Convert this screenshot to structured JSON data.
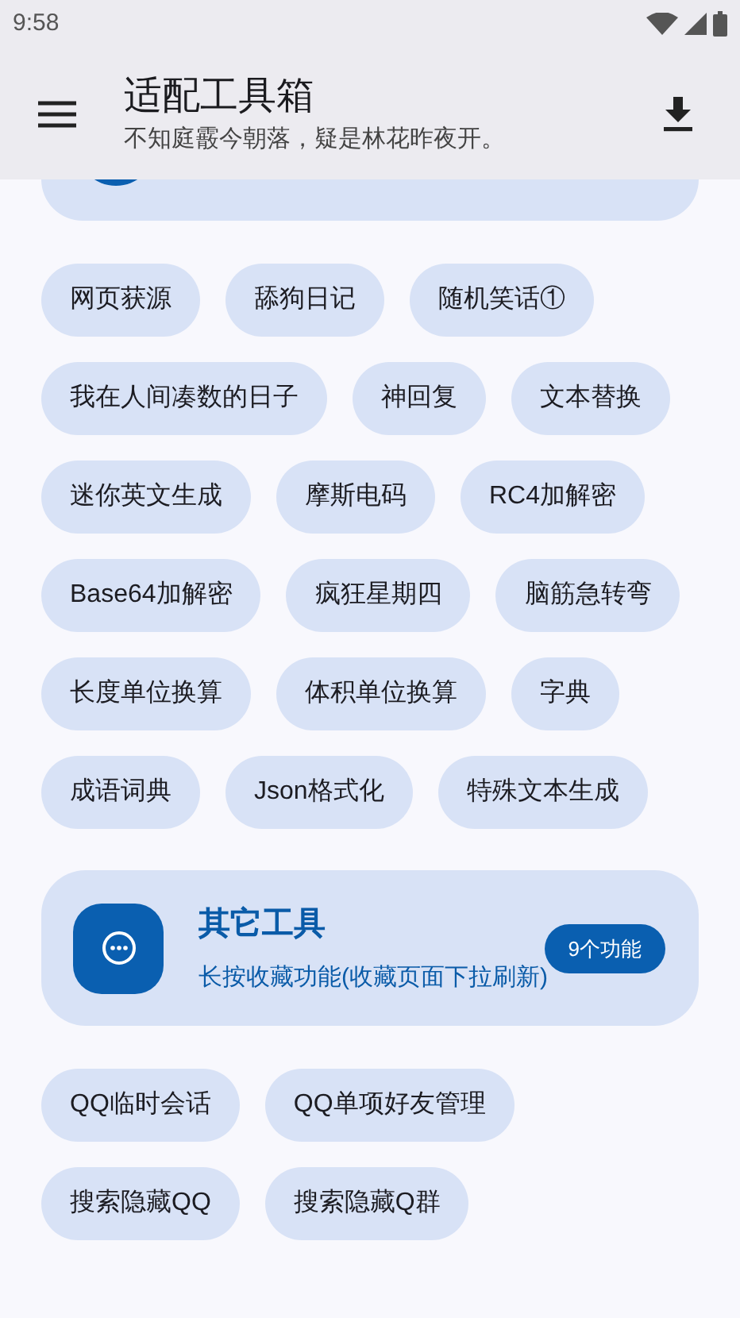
{
  "status_bar": {
    "time": "9:58"
  },
  "app_bar": {
    "title": "适配工具箱",
    "subtitle": "不知庭霰今朝落，疑是林花昨夜开。"
  },
  "tools_top": [
    "网页获源",
    "舔狗日记",
    "随机笑话①",
    "我在人间凑数的日子",
    "神回复",
    "文本替换",
    "迷你英文生成",
    "摩斯电码",
    "RC4加解密",
    "Base64加解密",
    "疯狂星期四",
    "脑筋急转弯",
    "长度单位换算",
    "体积单位换算",
    "字典",
    "成语词典",
    "Json格式化",
    "特殊文本生成"
  ],
  "category": {
    "title": "其它工具",
    "subtitle": "长按收藏功能(收藏页面下拉刷新)",
    "badge": "9个功能"
  },
  "tools_bottom": [
    "QQ临时会话",
    "QQ单项好友管理",
    "搜索隐藏QQ",
    "搜索隐藏Q群"
  ]
}
